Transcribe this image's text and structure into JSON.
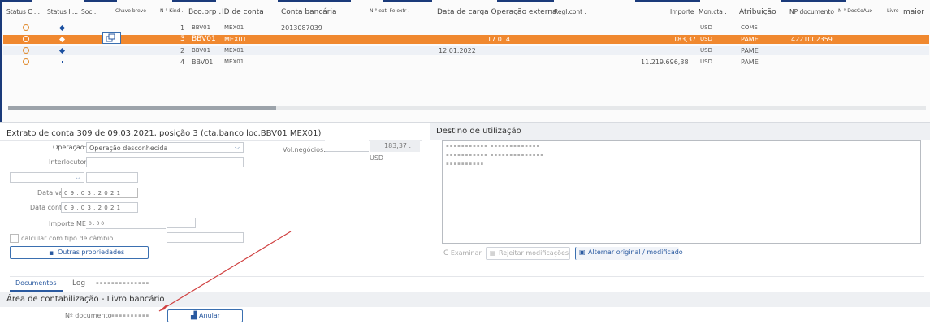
{
  "table": {
    "headers": {
      "status_c": "Status C ...",
      "status_i": "Status I ...",
      "soc": "Soc .",
      "chave_breve": "Chave breve",
      "n_kind": "N ° Kind .",
      "bco_prp": "Bco.prp .",
      "id_conta": "ID de conta",
      "conta_bancaria": "Conta bancária",
      "n_fe_extr": "N ° ext. Fe.extr .",
      "data_carga": "Data de carga Operação externa",
      "regl_cont": "Regl.cont .",
      "importe": "Importe",
      "mon_cta": "Mon.cta .",
      "atribuicao": "Atribuição",
      "np_documento": "NP documento",
      "n_doc_co_aux": "N ° DocCoAux",
      "livro": "Livro",
      "maior": "maior"
    },
    "rows": [
      {
        "n": "1",
        "bco": "BBV01",
        "id": "MEX01",
        "conta": "2013087039",
        "data_carga": "",
        "op": "",
        "importe": "",
        "mon": "USD",
        "atrib": "COMS",
        "np": "",
        "selected": false
      },
      {
        "n": "3",
        "bco": "BBV01",
        "id": "MEX01",
        "conta": "",
        "data_carga": "",
        "op": "17 014",
        "importe": "183,37",
        "mon": "USD",
        "atrib": "PAME",
        "np": "4221002359",
        "selected": true
      },
      {
        "n": "2",
        "bco": "BBV01",
        "id": "MEX01",
        "conta": "",
        "data_carga": "12.01.2022",
        "op": "",
        "importe": "",
        "mon": "USD",
        "atrib": "PAME",
        "np": "",
        "selected": false
      },
      {
        "n": "4",
        "bco": "BBV01",
        "id": "MEX01",
        "conta": "",
        "data_carga": "",
        "op": "",
        "importe": "11.219.696,38",
        "mon": "USD",
        "atrib": "PAME",
        "np": "",
        "selected": false
      }
    ]
  },
  "extrato": {
    "title": "Extrato de conta 309 de 09.03.2021, posição 3 (cta.banco loc.BBV01 MEX01)",
    "operacao_label": "Operação:",
    "operacao_value": "Operação desconhecida",
    "interlocutor_label": "Interlocutor :",
    "data_valor_label": "Data valor :",
    "data_valor_value": "0 9 . 0 3 . 2 0 2 1",
    "data_contabil_label": "Data contábil :",
    "data_contabil_value": "0 9 . 0 3 . 2 0 2 1",
    "importe_me_label": "Importe ME :",
    "importe_me_value": "0 . 0 0",
    "calcular_label": "calcular com tipo de câmbio",
    "outras_button": "Outras propriedades",
    "vol_negocios_label": "Vol.negócios:",
    "vol_negocios_value": "183,37",
    "vol_negocios_currency": ". USD"
  },
  "destino": {
    "title": "Destino de utilização",
    "examinar": "Examinar",
    "rejeitar": "Rejeitar modificações",
    "alternar": "Alternar original / modificado"
  },
  "tabs": {
    "documentos": "Documentos",
    "log": "Log"
  },
  "area": {
    "title": "Área de contabilização - Livro bancário",
    "n_documento_label": "Nº documento :",
    "anular_button": "Anular"
  },
  "colors": {
    "accent": "#f0882f",
    "brand": "#1a3a7a",
    "annotation": "#d04040"
  }
}
